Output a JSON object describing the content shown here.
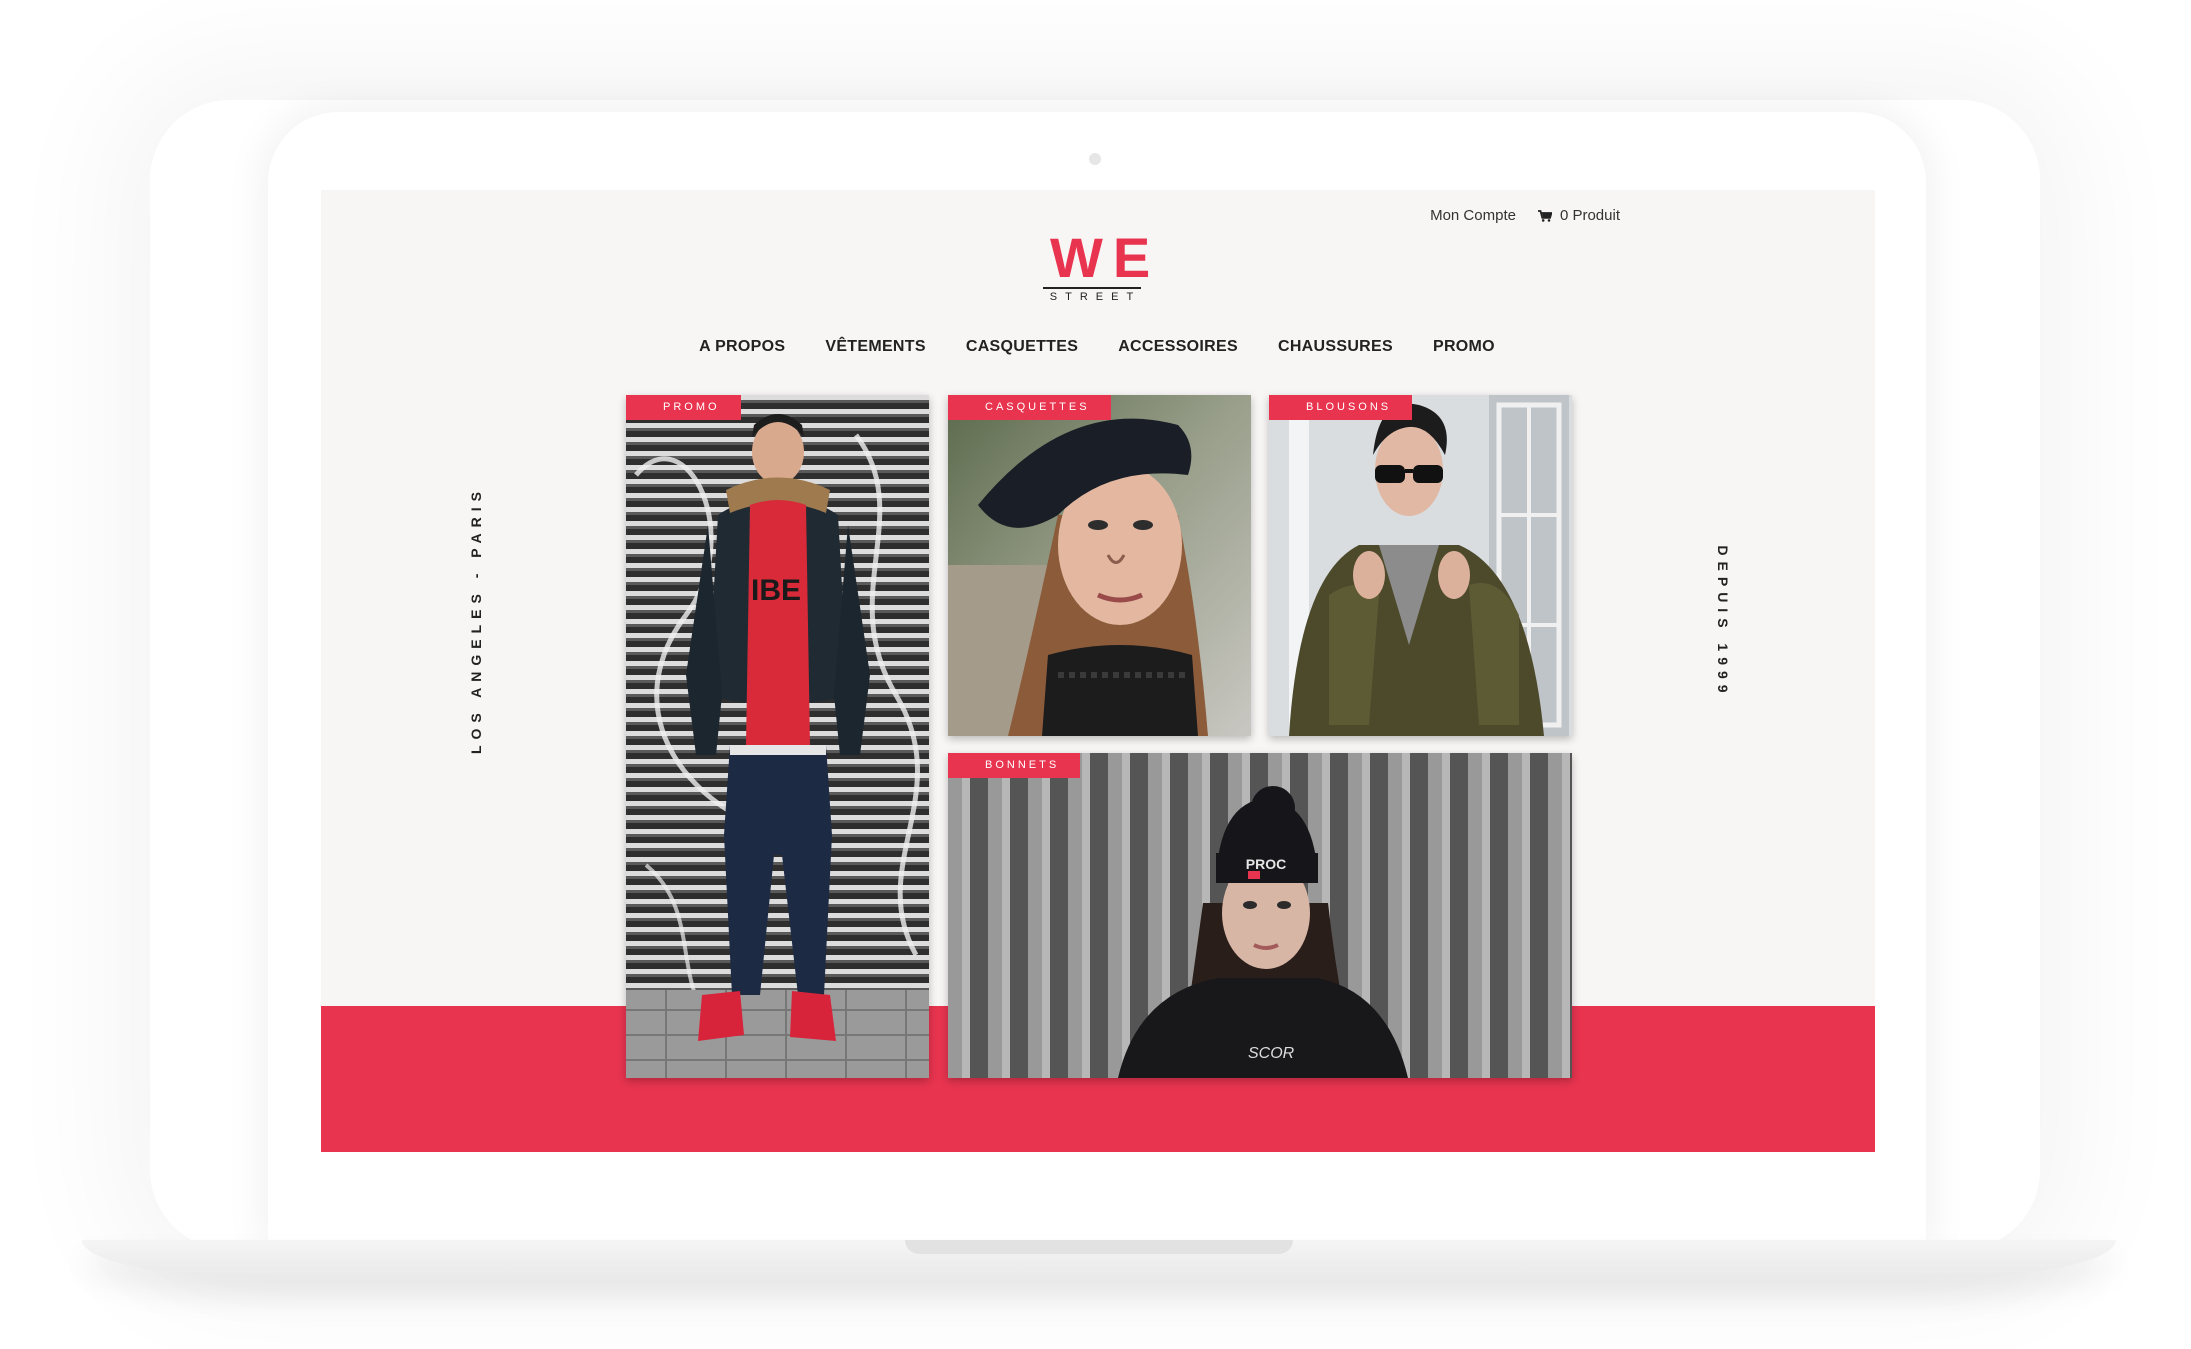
{
  "header": {
    "account_link": "Mon Compte",
    "cart_label": "0 Produit",
    "cart_icon": "cart-icon"
  },
  "logo": {
    "main": "WE",
    "sub": "STREET"
  },
  "nav": {
    "items": [
      {
        "label": "A PROPOS"
      },
      {
        "label": "VÊTEMENTS"
      },
      {
        "label": "CASQUETTES"
      },
      {
        "label": "ACCESSOIRES"
      },
      {
        "label": "CHAUSSURES"
      },
      {
        "label": "PROMO"
      }
    ]
  },
  "side": {
    "left": "LOS ANGELES - PARIS",
    "right": "DEPUIS 1999"
  },
  "tiles": [
    {
      "label": "PROMO"
    },
    {
      "label": "CASQUETTES"
    },
    {
      "label": "BLOUSONS"
    },
    {
      "label": "BONNETS"
    }
  ],
  "colors": {
    "accent": "#e8344f",
    "screen_bg": "#f7f6f5",
    "text": "#222222"
  }
}
